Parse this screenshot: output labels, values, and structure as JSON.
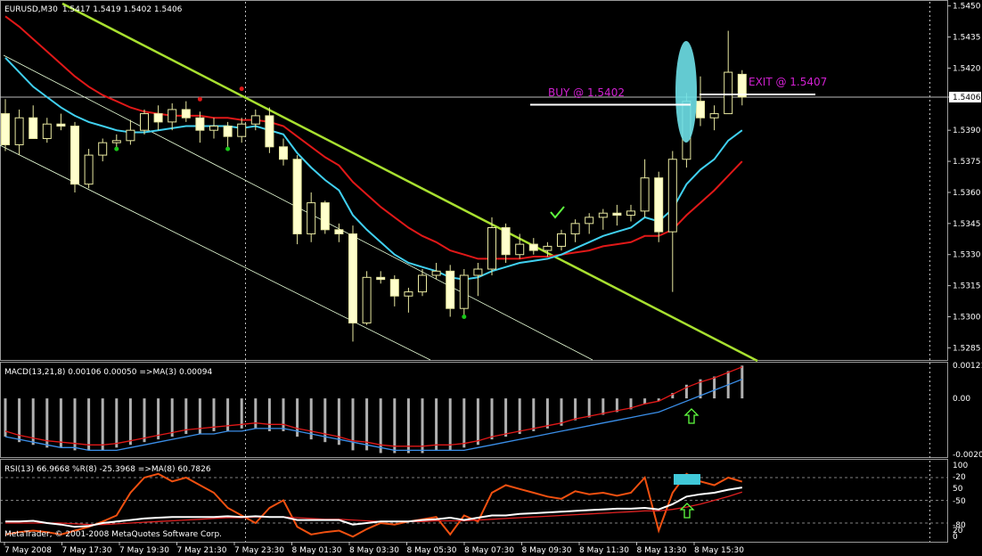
{
  "window": {
    "symbol_title": "EURUSD,M30",
    "ohlc_readout": "1.5417 1.5419 1.5402 1.5406",
    "copyright": "MetaTrader, © 2001-2008 MetaQuotes Software Corp."
  },
  "colors": {
    "background": "#000000",
    "candle_up": "#000000",
    "candle_down": "#ffffcc",
    "candle_outline": "#e8e8a0",
    "ma_fast": "#40d0f0",
    "ma_slow": "#e01818",
    "trend_line": "#a8e030",
    "channel_line": "#e8ffd8",
    "annotation": "#d020d0",
    "ellipse": "#6ee0e8",
    "macd_hist": "#b0b0b0",
    "macd_signal": "#3a8ee8",
    "rsi_line": "#ffffff",
    "rsi_ma": "#e02020",
    "wpr_line": "#f05010",
    "marker_up": "#80ff80"
  },
  "price_axis": {
    "ticks": [
      "1.5450",
      "1.5435",
      "1.5420",
      "1.5406",
      "1.5390",
      "1.5375",
      "1.5360",
      "1.5345",
      "1.5330",
      "1.5315",
      "1.5300",
      "1.5285"
    ],
    "current_price_label": "1.5406"
  },
  "time_axis": {
    "labels": [
      "7 May 2008",
      "7 May 17:30",
      "7 May 19:30",
      "7 May 21:30",
      "7 May 23:30",
      "8 May 01:30",
      "8 May 03:30",
      "8 May 05:30",
      "8 May 07:30",
      "8 May 09:30",
      "8 May 11:30",
      "8 May 13:30",
      "8 May 15:30"
    ]
  },
  "annotations": {
    "buy": "BUY @ 1.5402",
    "exit": "EXIT @ 1.5407",
    "buy_price": 1.5402,
    "exit_price": 1.5407
  },
  "macd_panel": {
    "title": "MACD(13,21,8) 0.00106 0.00050  =>MA(3) 0.00094",
    "ticks": [
      "0.00121",
      "0.00",
      "-0.00205"
    ]
  },
  "rsi_panel": {
    "title": "RSI(13) 66.9668  %R(8) -25.3968  =>MA(8) 60.7826",
    "ticks": [
      "100",
      "-20",
      "50",
      "-50",
      "-80",
      "20",
      "0"
    ]
  },
  "chart_data": {
    "type": "candlestick",
    "title": "EURUSD,M30",
    "ylim": [
      1.528,
      1.5452
    ],
    "candles": [
      [
        1.5398,
        1.5405,
        1.538,
        1.5383
      ],
      [
        1.5383,
        1.54,
        1.5378,
        1.5396
      ],
      [
        1.5396,
        1.5402,
        1.539,
        1.5386
      ],
      [
        1.5386,
        1.5396,
        1.5384,
        1.5393
      ],
      [
        1.5393,
        1.5398,
        1.539,
        1.5392
      ],
      [
        1.5392,
        1.5394,
        1.536,
        1.5364
      ],
      [
        1.5364,
        1.5381,
        1.5362,
        1.5378
      ],
      [
        1.5378,
        1.5386,
        1.5375,
        1.5384
      ],
      [
        1.5384,
        1.5388,
        1.538,
        1.5385
      ],
      [
        1.5385,
        1.5395,
        1.5383,
        1.539
      ],
      [
        1.539,
        1.54,
        1.5388,
        1.5398
      ],
      [
        1.5398,
        1.5402,
        1.539,
        1.5394
      ],
      [
        1.5394,
        1.5403,
        1.539,
        1.54
      ],
      [
        1.54,
        1.5404,
        1.5394,
        1.5396
      ],
      [
        1.5396,
        1.5399,
        1.5384,
        1.539
      ],
      [
        1.539,
        1.5396,
        1.5386,
        1.5392
      ],
      [
        1.5392,
        1.5394,
        1.5382,
        1.5387
      ],
      [
        1.5387,
        1.5396,
        1.5384,
        1.5393
      ],
      [
        1.5393,
        1.54,
        1.539,
        1.5397
      ],
      [
        1.5397,
        1.5401,
        1.5379,
        1.5382
      ],
      [
        1.5382,
        1.5386,
        1.5373,
        1.5376
      ],
      [
        1.5376,
        1.5378,
        1.5335,
        1.534
      ],
      [
        1.534,
        1.536,
        1.5336,
        1.5355
      ],
      [
        1.5355,
        1.5356,
        1.534,
        1.5342
      ],
      [
        1.5342,
        1.5345,
        1.5336,
        1.534
      ],
      [
        1.534,
        1.5344,
        1.5288,
        1.5297
      ],
      [
        1.5297,
        1.5322,
        1.5296,
        1.5319
      ],
      [
        1.5319,
        1.5322,
        1.5316,
        1.5318
      ],
      [
        1.5318,
        1.532,
        1.5305,
        1.531
      ],
      [
        1.531,
        1.5314,
        1.5302,
        1.5312
      ],
      [
        1.5312,
        1.5323,
        1.531,
        1.532
      ],
      [
        1.532,
        1.5326,
        1.5318,
        1.5322
      ],
      [
        1.5322,
        1.5325,
        1.53,
        1.5304
      ],
      [
        1.5304,
        1.5323,
        1.53,
        1.532
      ],
      [
        1.532,
        1.5326,
        1.531,
        1.5323
      ],
      [
        1.5323,
        1.5348,
        1.532,
        1.5343
      ],
      [
        1.5343,
        1.5345,
        1.5326,
        1.533
      ],
      [
        1.533,
        1.534,
        1.5328,
        1.5335
      ],
      [
        1.5335,
        1.5338,
        1.533,
        1.5332
      ],
      [
        1.5332,
        1.5336,
        1.5329,
        1.5334
      ],
      [
        1.5334,
        1.5342,
        1.5332,
        1.534
      ],
      [
        1.534,
        1.5347,
        1.5336,
        1.5345
      ],
      [
        1.5345,
        1.535,
        1.534,
        1.5348
      ],
      [
        1.5348,
        1.5352,
        1.5342,
        1.535
      ],
      [
        1.535,
        1.5354,
        1.5344,
        1.5349
      ],
      [
        1.5349,
        1.5354,
        1.5346,
        1.5351
      ],
      [
        1.5351,
        1.5376,
        1.5348,
        1.5367
      ],
      [
        1.5367,
        1.537,
        1.5336,
        1.5341
      ],
      [
        1.5341,
        1.538,
        1.5312,
        1.5376
      ],
      [
        1.5376,
        1.5408,
        1.5372,
        1.5404
      ],
      [
        1.5404,
        1.5416,
        1.5392,
        1.5396
      ],
      [
        1.5396,
        1.5402,
        1.539,
        1.5398
      ],
      [
        1.5398,
        1.5438,
        1.5402,
        1.5418
      ],
      [
        1.5417,
        1.5419,
        1.5402,
        1.5406
      ]
    ],
    "ma_fast_series": [
      1.5425,
      1.5418,
      1.5411,
      1.5406,
      1.5401,
      1.5397,
      1.5394,
      1.5392,
      1.539,
      1.5389,
      1.5389,
      1.539,
      1.5391,
      1.5392,
      1.5392,
      1.5392,
      1.5392,
      1.5391,
      1.5392,
      1.539,
      1.5388,
      1.5379,
      1.5372,
      1.5366,
      1.5361,
      1.5349,
      1.5342,
      1.5336,
      1.533,
      1.5326,
      1.5324,
      1.5322,
      1.5319,
      1.5318,
      1.5319,
      1.5322,
      1.5324,
      1.5326,
      1.5327,
      1.5328,
      1.533,
      1.5333,
      1.5336,
      1.5339,
      1.5341,
      1.5343,
      1.5348,
      1.5346,
      1.5352,
      1.5364,
      1.5371,
      1.5376,
      1.5385,
      1.539
    ],
    "ma_slow_series": [
      1.5445,
      1.544,
      1.5434,
      1.5428,
      1.5422,
      1.5416,
      1.5411,
      1.5407,
      1.5404,
      1.5401,
      1.5399,
      1.5398,
      1.5397,
      1.5397,
      1.5397,
      1.5396,
      1.5396,
      1.5395,
      1.5395,
      1.5394,
      1.5392,
      1.5387,
      1.5382,
      1.5377,
      1.5373,
      1.5365,
      1.5359,
      1.5353,
      1.5348,
      1.5343,
      1.5339,
      1.5336,
      1.5332,
      1.533,
      1.5328,
      1.5328,
      1.5328,
      1.5328,
      1.5329,
      1.5329,
      1.533,
      1.5331,
      1.5332,
      1.5334,
      1.5335,
      1.5336,
      1.5339,
      1.5339,
      1.5342,
      1.5349,
      1.5355,
      1.5361,
      1.5368,
      1.5375
    ],
    "macd_hist": [
      -0.0014,
      -0.0016,
      -0.0017,
      -0.0018,
      -0.0018,
      -0.0019,
      -0.0019,
      -0.0019,
      -0.0018,
      -0.0017,
      -0.0016,
      -0.0015,
      -0.0014,
      -0.0013,
      -0.0013,
      -0.0012,
      -0.0012,
      -0.0011,
      -0.0011,
      -0.0012,
      -0.0012,
      -0.0014,
      -0.0015,
      -0.0016,
      -0.0017,
      -0.0019,
      -0.0019,
      -0.002,
      -0.002,
      -0.002,
      -0.002,
      -0.0019,
      -0.0019,
      -0.0018,
      -0.0017,
      -0.0015,
      -0.0014,
      -0.0013,
      -0.0012,
      -0.0011,
      -0.001,
      -0.0008,
      -0.0007,
      -0.0006,
      -0.0005,
      -0.0004,
      -0.0002,
      -0.0001,
      0.0002,
      0.0005,
      0.0007,
      0.0008,
      0.001,
      0.0012
    ],
    "macd_signal": [
      -0.0014,
      -0.0015,
      -0.0016,
      -0.0017,
      -0.0018,
      -0.0018,
      -0.0019,
      -0.0019,
      -0.0019,
      -0.0018,
      -0.0017,
      -0.0016,
      -0.0015,
      -0.0014,
      -0.0013,
      -0.0013,
      -0.0012,
      -0.0012,
      -0.0011,
      -0.0011,
      -0.0011,
      -0.0012,
      -0.0013,
      -0.0014,
      -0.0015,
      -0.0016,
      -0.0017,
      -0.0018,
      -0.0019,
      -0.0019,
      -0.0019,
      -0.0019,
      -0.0019,
      -0.0019,
      -0.0018,
      -0.0017,
      -0.0016,
      -0.0015,
      -0.0014,
      -0.0013,
      -0.0012,
      -0.0011,
      -0.001,
      -0.0009,
      -0.0008,
      -0.0007,
      -0.0006,
      -0.0005,
      -0.0003,
      -0.0001,
      0.0001,
      0.0003,
      0.0005,
      0.0007
    ],
    "rsi_series": [
      22,
      22,
      23,
      20,
      18,
      15,
      16,
      20,
      22,
      24,
      26,
      27,
      28,
      28,
      28,
      28,
      29,
      28,
      29,
      28,
      28,
      24,
      24,
      24,
      24,
      18,
      20,
      22,
      22,
      22,
      24,
      25,
      27,
      24,
      27,
      30,
      30,
      32,
      33,
      34,
      35,
      36,
      37,
      38,
      39,
      39,
      40,
      38,
      45,
      55,
      58,
      60,
      64,
      66.97
    ],
    "rsi_ma_series": [
      20,
      20,
      20,
      20,
      20,
      19,
      18,
      18,
      19,
      20,
      21,
      22,
      23,
      24,
      25,
      26,
      27,
      27,
      28,
      28,
      28,
      27,
      26,
      25,
      25,
      24,
      23,
      22,
      22,
      22,
      22,
      23,
      23,
      23,
      24,
      25,
      26,
      27,
      28,
      29,
      30,
      31,
      32,
      33,
      34,
      35,
      36,
      36,
      38,
      41,
      45,
      50,
      55,
      60.78
    ],
    "wpr_series": [
      -95,
      -92,
      -90,
      -92,
      -95,
      -90,
      -85,
      -78,
      -70,
      -40,
      -20,
      -15,
      -25,
      -20,
      -30,
      -40,
      -60,
      -70,
      -80,
      -60,
      -50,
      -85,
      -95,
      -92,
      -90,
      -98,
      -88,
      -80,
      -82,
      -78,
      -75,
      -72,
      -95,
      -70,
      -78,
      -40,
      -30,
      -35,
      -40,
      -45,
      -48,
      -38,
      -42,
      -40,
      -44,
      -40,
      -20,
      -90,
      -40,
      -15,
      -25,
      -30,
      -20,
      -25.4
    ]
  }
}
